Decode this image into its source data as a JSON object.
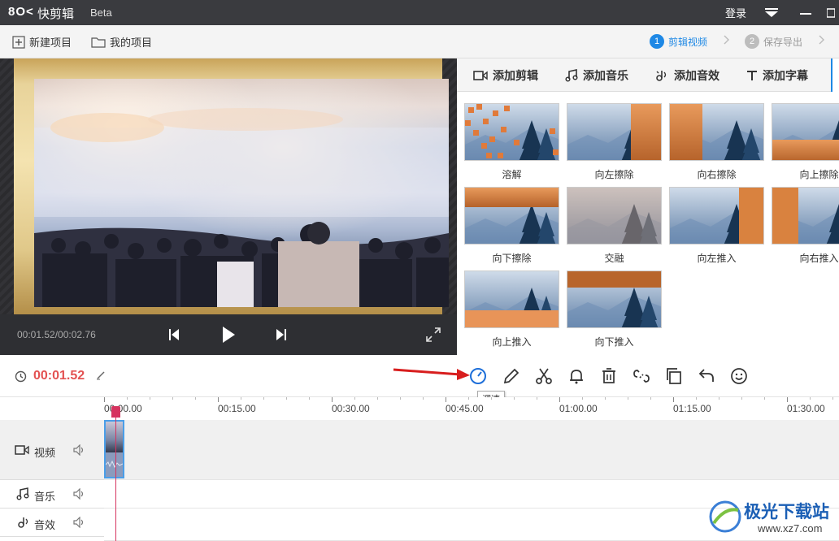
{
  "app": {
    "logo": "8O<",
    "name": "快剪辑",
    "beta": "Beta",
    "login": "登录"
  },
  "project_bar": {
    "new_project": "新建项目",
    "my_projects": "我的项目"
  },
  "steps": [
    {
      "num": "1",
      "label": "剪辑视频",
      "active": true
    },
    {
      "num": "2",
      "label": "保存导出",
      "active": false
    }
  ],
  "preview": {
    "timecode": "00:01.52/00:02.76"
  },
  "tabs": [
    {
      "label": "添加剪辑",
      "icon": "video-camera-icon"
    },
    {
      "label": "添加音乐",
      "icon": "music-note-icon"
    },
    {
      "label": "添加音效",
      "icon": "sound-effect-icon"
    },
    {
      "label": "添加字幕",
      "icon": "text-t-icon"
    }
  ],
  "transitions": [
    "溶解",
    "向左擦除",
    "向右擦除",
    "向上擦除",
    "向下擦除",
    "交融",
    "向左推入",
    "向右推入",
    "向上推入",
    "向下推入"
  ],
  "toolbar": {
    "current_time": "00:01.52",
    "tooltip": "调速",
    "tools": [
      "speed-icon",
      "edit-pencil-icon",
      "scissors-icon",
      "bell-icon",
      "delete-trash-icon",
      "detach-icon",
      "copy-icon",
      "undo-icon",
      "sticker-smile-icon"
    ]
  },
  "timeline": {
    "ticks": [
      "00:00.00",
      "00:15.00",
      "00:30.00",
      "00:45.00",
      "01:00.00",
      "01:15.00",
      "01:30.00"
    ],
    "tracks": [
      {
        "label": "视频",
        "icon": "video-camera-icon"
      },
      {
        "label": "音乐",
        "icon": "music-note-icon"
      },
      {
        "label": "音效",
        "icon": "sound-effect-icon"
      }
    ]
  },
  "watermark": {
    "brand": "极光下载站",
    "url": "www.xz7.com"
  },
  "colors": {
    "accent": "#1e88e5",
    "time_red": "#e35252",
    "playhead": "#d6335f",
    "arrow": "#d81e1e"
  }
}
